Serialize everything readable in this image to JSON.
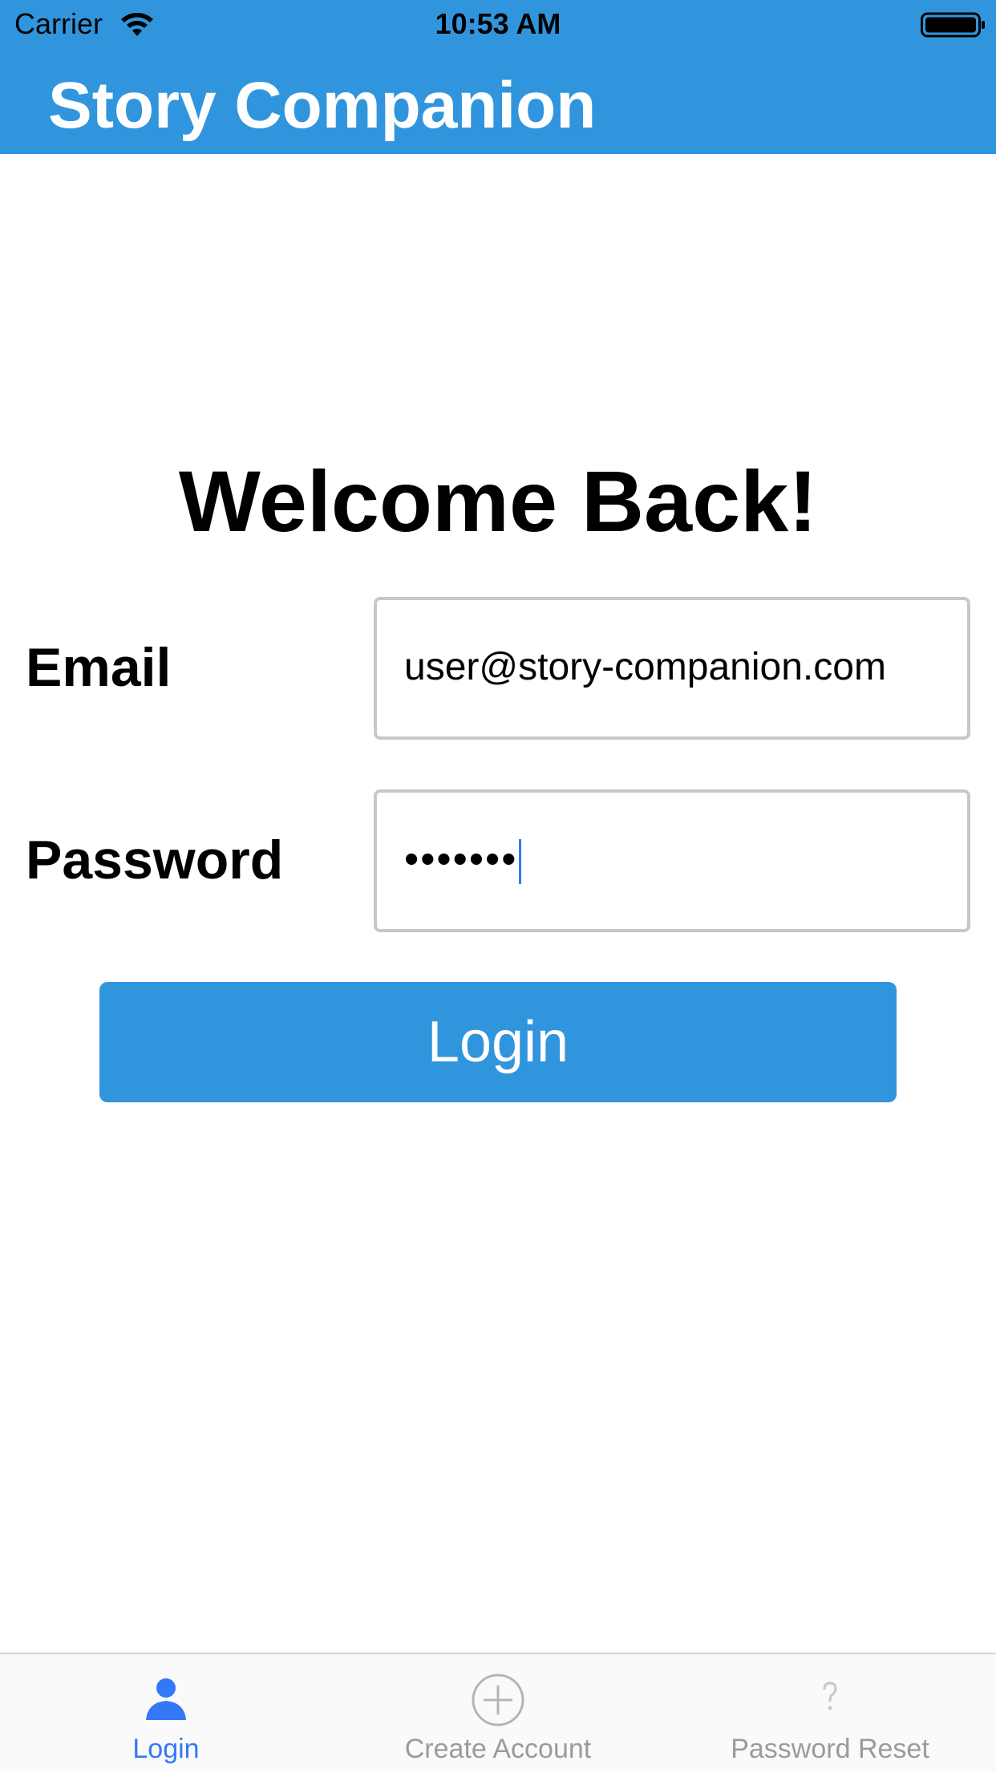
{
  "status_bar": {
    "carrier": "Carrier",
    "time": "10:53 AM",
    "icons": [
      "wifi-icon",
      "battery-icon"
    ]
  },
  "nav": {
    "title": "Story Companion"
  },
  "login": {
    "heading": "Welcome Back!",
    "email_label": "Email",
    "email_value": "user@story-companion.com",
    "password_label": "Password",
    "password_value": "•••••••",
    "button_label": "Login"
  },
  "tab_bar": {
    "items": [
      {
        "label": "Login",
        "icon": "person-icon",
        "selected": true
      },
      {
        "label": "Create Account",
        "icon": "plus-circle-icon",
        "selected": false
      },
      {
        "label": "Password Reset",
        "icon": "question-icon",
        "selected": false
      }
    ]
  },
  "colors": {
    "accent": "#3195de",
    "tab_selected": "#3478f6",
    "tab_unselected": "#9b9b9b"
  }
}
